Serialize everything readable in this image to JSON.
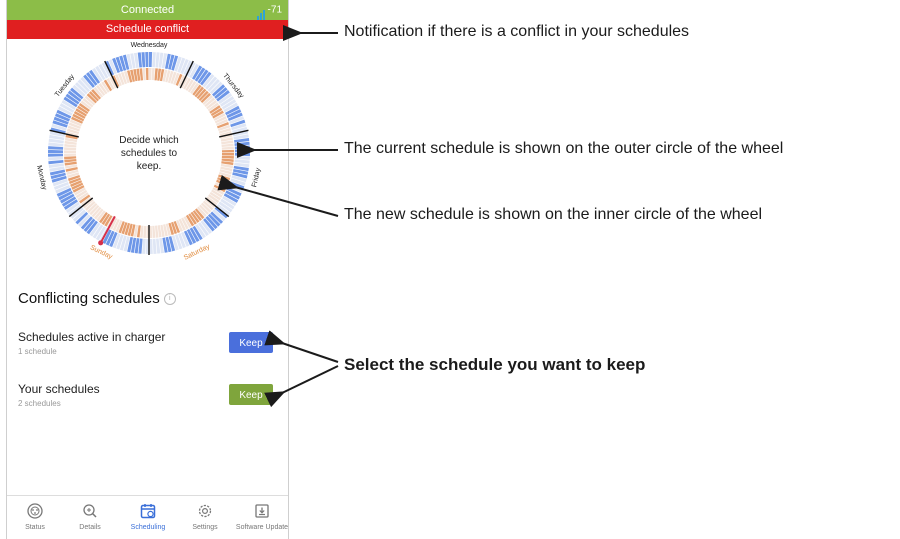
{
  "status_bar": {
    "text": "Connected",
    "signal": "-71"
  },
  "conflict_banner": {
    "text": "Schedule conflict"
  },
  "wheel": {
    "center_text": "Decide which\nschedules to\nkeep.",
    "days": [
      "Wednesday",
      "Thursday",
      "Friday",
      "Saturday",
      "Sunday",
      "Monday",
      "Tuesday"
    ],
    "highlight_days": [
      "Saturday",
      "Sunday"
    ],
    "colors": {
      "outer": "#6e97e8",
      "inner": "#e6a070",
      "today": "#d6304a",
      "weekend_label": "#e08a3c"
    }
  },
  "conflicts": {
    "title": "Conflicting schedules",
    "rows": [
      {
        "title": "Schedules active in charger",
        "subtitle": "1 schedule",
        "button": "Keep",
        "color": "#4a6fdc"
      },
      {
        "title": "Your schedules",
        "subtitle": "2 schedules",
        "button": "Keep",
        "color": "#7fa53c"
      }
    ]
  },
  "tabs": [
    {
      "label": "Status",
      "icon": "status-icon"
    },
    {
      "label": "Details",
      "icon": "details-icon"
    },
    {
      "label": "Scheduling",
      "icon": "scheduling-icon",
      "active": true
    },
    {
      "label": "Settings",
      "icon": "settings-icon"
    },
    {
      "label": "Software Update",
      "icon": "software-update-icon"
    }
  ],
  "annotations": {
    "conflict": "Notification if there is a conflict in your schedules",
    "outer": "The current schedule is shown on the outer circle of the wheel",
    "inner": "The new schedule is shown on the inner circle of the wheel",
    "keep": "Select the schedule you want to keep"
  }
}
